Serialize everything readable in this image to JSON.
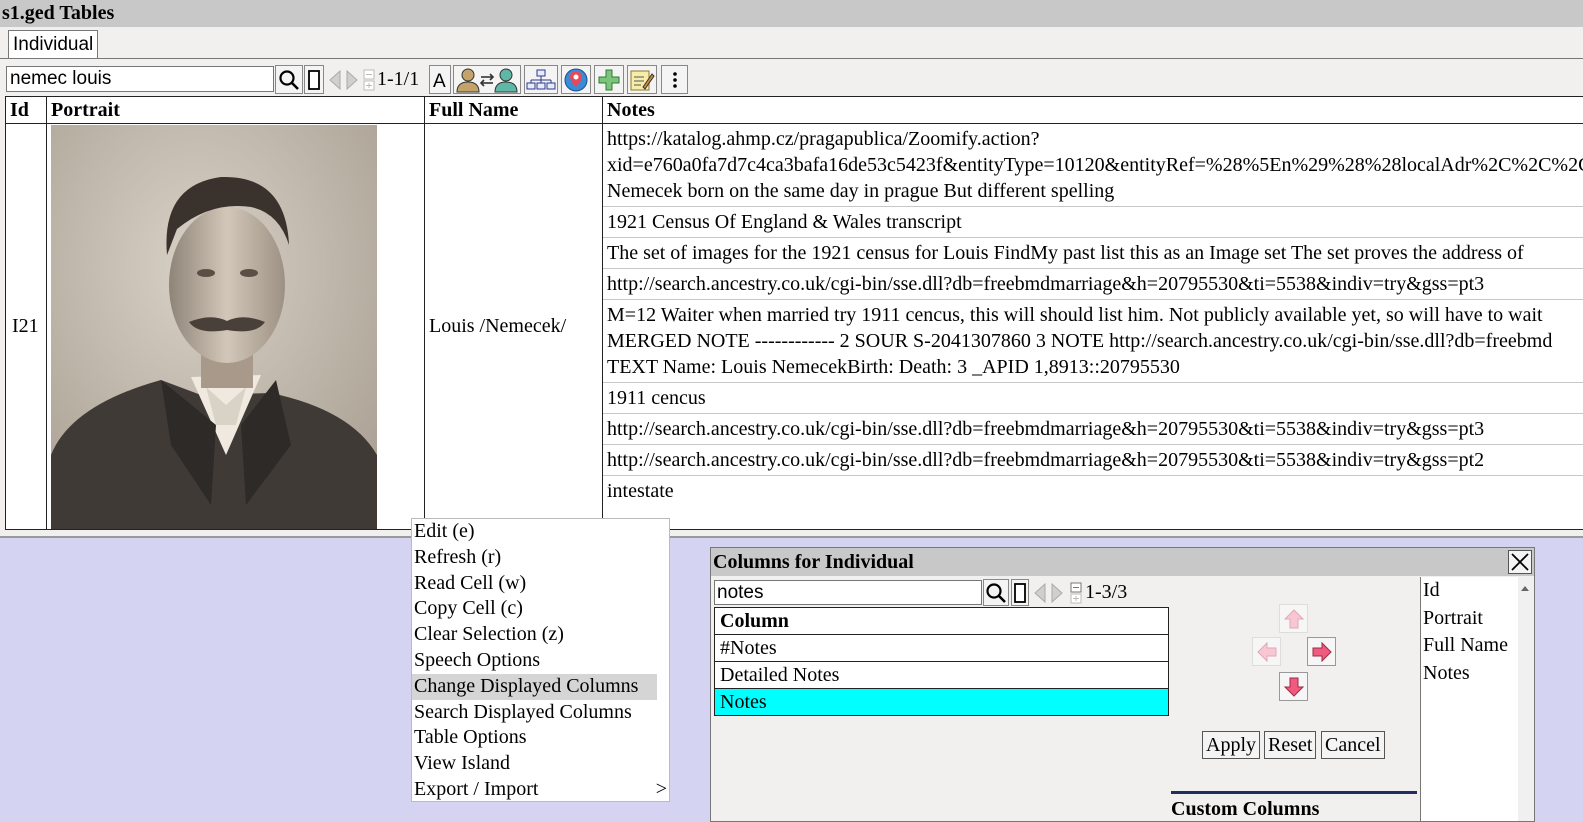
{
  "window": {
    "title": "s1.ged Tables",
    "tab_label": "Individual",
    "search_value": "nemec louis",
    "pager": "1-1/1"
  },
  "table": {
    "headers": [
      "Id",
      "Portrait",
      "Full Name",
      "Notes"
    ],
    "row": {
      "id": "I21",
      "full_name": "Louis /Nemecek/",
      "notes": [
        [
          "https://katalog.ahmp.cz/pragapublica/Zoomify.action?",
          "xid=e760a0fa7d7c4ca3bafa16de53c5423f&entityType=10120&entityRef=%28%5En%29%28%28localAdr%2C%2C%2C%2C",
          "Nemecek born on the same day in prague But different spelling"
        ],
        [
          "1921 Census Of England & Wales transcript"
        ],
        [
          "The set of images for the 1921 census for Louis FindMy past list this as an Image set The set proves the address of"
        ],
        [
          "http://search.ancestry.co.uk/cgi-bin/sse.dll?db=freebmdmarriage&h=20795530&ti=5538&indiv=try&gss=pt3"
        ],
        [
          "M=12 Waiter when married try 1911 cencus, this will should list him. Not publicly available yet, so will have to wait",
          "MERGED NOTE ------------ 2 SOUR S-2041307860 3 NOTE http://search.ancestry.co.uk/cgi-bin/sse.dll?db=freebmd",
          "TEXT Name: Louis NemecekBirth: Death: 3 _APID 1,8913::20795530"
        ],
        [
          "1911 cencus"
        ],
        [
          "http://search.ancestry.co.uk/cgi-bin/sse.dll?db=freebmdmarriage&h=20795530&ti=5538&indiv=try&gss=pt3"
        ],
        [
          "http://search.ancestry.co.uk/cgi-bin/sse.dll?db=freebmdmarriage&h=20795530&ti=5538&indiv=try&gss=pt2"
        ],
        [
          "intestate"
        ]
      ]
    }
  },
  "context_menu": {
    "items": [
      {
        "label": "Edit (e)"
      },
      {
        "label": "Refresh (r)"
      },
      {
        "label": "Read Cell (w)"
      },
      {
        "label": "Copy Cell (c)"
      },
      {
        "label": "Clear Selection (z)"
      },
      {
        "label": "Speech Options"
      },
      {
        "label": "Change Displayed Columns",
        "selected": true
      },
      {
        "label": "Search Displayed Columns"
      },
      {
        "label": "Table Options"
      },
      {
        "label": "View Island"
      },
      {
        "label": "Export / Import",
        "submenu": ">"
      }
    ]
  },
  "columns_dialog": {
    "title": "Columns for Individual",
    "search_value": "notes",
    "pager": "1-3/3",
    "list_header": "Column",
    "list_items": [
      {
        "label": "#Notes"
      },
      {
        "label": "Detailed Notes"
      },
      {
        "label": "Notes",
        "selected": true
      }
    ],
    "buttons": {
      "apply": "Apply",
      "reset": "Reset",
      "cancel": "Cancel"
    },
    "custom_columns_label": "Custom Columns",
    "displayed_columns": [
      "Id",
      "Portrait",
      "Full Name",
      "Notes"
    ]
  },
  "colors": {
    "background": "#d4d4f2",
    "titlebar": "#c8c8c8",
    "selection": "#00ffff",
    "arrow_pink": "#f05a7e"
  }
}
